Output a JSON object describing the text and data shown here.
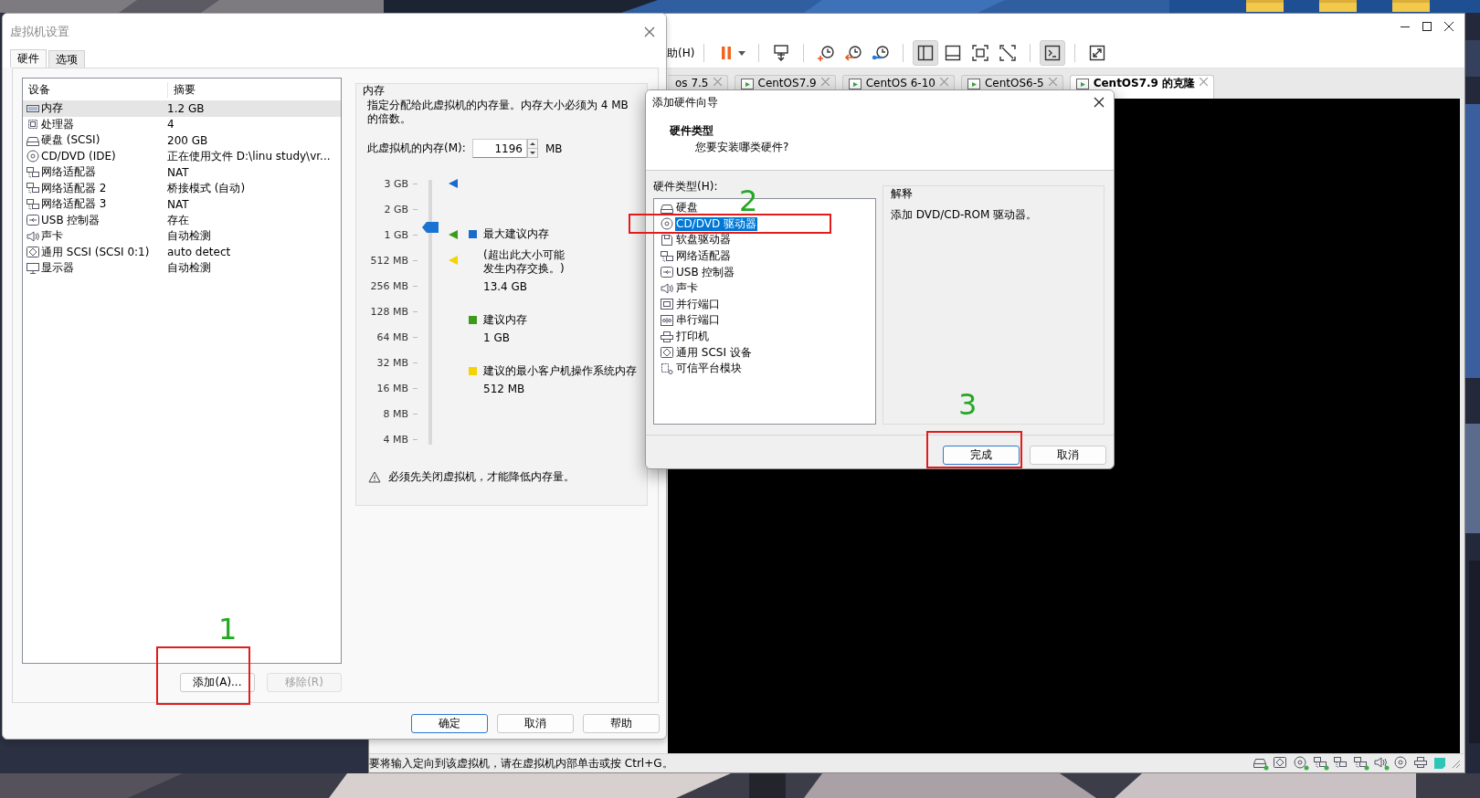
{
  "main_window": {
    "menu_item": "助(H)",
    "toolbar": [
      {
        "kind": "pause",
        "on": false
      },
      {
        "kind": "send_keys",
        "on": false
      },
      {
        "kind": "snapshot",
        "on": false
      },
      {
        "kind": "revert",
        "on": false
      },
      {
        "kind": "snapshot_manager",
        "on": false
      },
      {
        "kind": "library",
        "on": true
      },
      {
        "kind": "thumbnails",
        "on": false
      },
      {
        "kind": "fullscreen",
        "on": false
      },
      {
        "kind": "unity",
        "on": false
      },
      {
        "kind": "console",
        "on": true
      },
      {
        "kind": "stretch",
        "on": false
      }
    ],
    "tabs": [
      {
        "label": "os 7.5",
        "selected": false,
        "cut": true
      },
      {
        "label": "CentOS7.9",
        "selected": false,
        "cut": false
      },
      {
        "label": "CentOS 6-10",
        "selected": false,
        "cut": false
      },
      {
        "label": "CentOS6-5",
        "selected": false,
        "cut": false
      },
      {
        "label": "CentOS7.9 的克隆",
        "selected": true,
        "cut": false
      }
    ],
    "status_text": "要将输入定向到该虚拟机，请在虚拟机内部单击或按 Ctrl+G。"
  },
  "settings_dialog": {
    "title": "虚拟机设置",
    "tabs": [
      {
        "label": "硬件",
        "selected": true
      },
      {
        "label": "选项",
        "selected": false
      }
    ],
    "columns": [
      "设备",
      "摘要"
    ],
    "devices": [
      {
        "kind": "memory",
        "name": "内存",
        "summary": "1.2 GB",
        "selected": true
      },
      {
        "kind": "cpu",
        "name": "处理器",
        "summary": "4",
        "selected": false
      },
      {
        "kind": "disk",
        "name": "硬盘 (SCSI)",
        "summary": "200 GB",
        "selected": false
      },
      {
        "kind": "cd",
        "name": "CD/DVD (IDE)",
        "summary": "正在使用文件 D:\\linu study\\vr...",
        "selected": false
      },
      {
        "kind": "net",
        "name": "网络适配器",
        "summary": "NAT",
        "selected": false
      },
      {
        "kind": "net",
        "name": "网络适配器 2",
        "summary": "桥接模式 (自动)",
        "selected": false
      },
      {
        "kind": "net",
        "name": "网络适配器 3",
        "summary": "NAT",
        "selected": false
      },
      {
        "kind": "usb",
        "name": "USB 控制器",
        "summary": "存在",
        "selected": false
      },
      {
        "kind": "sound",
        "name": "声卡",
        "summary": "自动检测",
        "selected": false
      },
      {
        "kind": "scsi",
        "name": "通用 SCSI (SCSI 0:1)",
        "summary": "auto detect",
        "selected": false
      },
      {
        "kind": "display",
        "name": "显示器",
        "summary": "自动检测",
        "selected": false
      }
    ],
    "list_buttons": [
      {
        "label": "添加(A)...",
        "disabled": false
      },
      {
        "label": "移除(R)",
        "disabled": true
      }
    ],
    "memory": {
      "title": "内存",
      "description": "指定分配给此虚拟机的内存量。内存大小必须为 4 MB 的倍数。",
      "field_label": "此虚拟机的内存(M):",
      "value": "1196",
      "unit": "MB",
      "scale": [
        "3 GB",
        "2 GB",
        "1 GB",
        "512 MB",
        "256 MB",
        "128 MB",
        "64 MB",
        "32 MB",
        "16 MB",
        "8 MB",
        "4 MB"
      ],
      "level": 0.83,
      "legend": [
        {
          "color": "#1a6cc8",
          "label": "最大建议内存",
          "note": "(超出此大小可能发生内存交换。)",
          "value": "13.4 GB"
        },
        {
          "color": "#3f9a1c",
          "label": "建议内存",
          "value": "1 GB"
        },
        {
          "color": "#f3d300",
          "label": "建议的最小客户机操作系统内存",
          "value": "512 MB"
        }
      ],
      "warning": "必须先关闭虚拟机，才能降低内存量。"
    },
    "buttons": [
      {
        "label": "确定",
        "primary": true
      },
      {
        "label": "取消",
        "primary": false
      },
      {
        "label": "帮助",
        "primary": false
      }
    ]
  },
  "wizard": {
    "title": "添加硬件向导",
    "heading": "硬件类型",
    "subheading": "您要安装哪类硬件?",
    "list_label": "硬件类型(H):",
    "items": [
      {
        "kind": "disk",
        "label": "硬盘",
        "selected": false
      },
      {
        "kind": "cd",
        "label": "CD/DVD 驱动器",
        "selected": true
      },
      {
        "kind": "floppy",
        "label": "软盘驱动器",
        "selected": false
      },
      {
        "kind": "net",
        "label": "网络适配器",
        "selected": false
      },
      {
        "kind": "usb",
        "label": "USB 控制器",
        "selected": false
      },
      {
        "kind": "sound",
        "label": "声卡",
        "selected": false
      },
      {
        "kind": "parallel",
        "label": "并行端口",
        "selected": false
      },
      {
        "kind": "serial",
        "label": "串行端口",
        "selected": false
      },
      {
        "kind": "printer",
        "label": "打印机",
        "selected": false
      },
      {
        "kind": "scsi",
        "label": "通用 SCSI 设备",
        "selected": false
      },
      {
        "kind": "tpm",
        "label": "可信平台模块",
        "selected": false
      }
    ],
    "explanation_title": "解释",
    "explanation": "添加 DVD/CD-ROM 驱动器。",
    "buttons": [
      {
        "label": "完成",
        "primary": true
      },
      {
        "label": "取消",
        "primary": false
      }
    ]
  },
  "annotations": [
    {
      "label": "1"
    },
    {
      "label": "2"
    },
    {
      "label": "3"
    }
  ]
}
